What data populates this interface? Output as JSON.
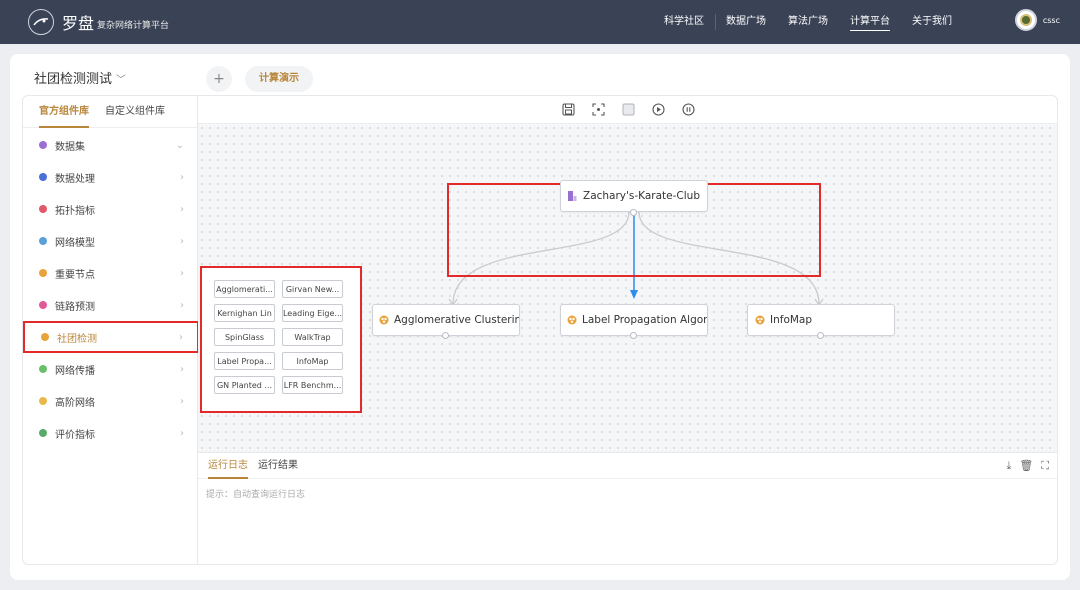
{
  "header": {
    "logo_title": "罗盘",
    "logo_subtitle": "复杂网络计算平台",
    "nav": [
      "科学社区",
      "数据广场",
      "算法广场",
      "计算平台",
      "关于我们"
    ],
    "active_nav": "计算平台",
    "user": "cssc"
  },
  "project": {
    "title": "社团检测测试",
    "add_label": "+",
    "demo_button": "计算演示"
  },
  "sidebar": {
    "tabs": [
      "官方组件库",
      "自定义组件库"
    ],
    "items": [
      {
        "label": "数据集",
        "icon": "dataset-icon",
        "color": "#9b6fd1",
        "arrow": "⌄"
      },
      {
        "label": "数据处理",
        "icon": "data-process-icon",
        "color": "#4a6fd8",
        "arrow": "›"
      },
      {
        "label": "拓扑指标",
        "icon": "topology-icon",
        "color": "#e05a6a",
        "arrow": "›"
      },
      {
        "label": "网络模型",
        "icon": "network-model-icon",
        "color": "#5aa0d8",
        "arrow": "›"
      },
      {
        "label": "重要节点",
        "icon": "key-node-icon",
        "color": "#e8a33a",
        "arrow": "›"
      },
      {
        "label": "链路预测",
        "icon": "link-predict-icon",
        "color": "#e05a9a",
        "arrow": "›"
      },
      {
        "label": "社团检测",
        "icon": "community-icon",
        "color": "#e8a33a",
        "arrow": "›"
      },
      {
        "label": "网络传播",
        "icon": "spread-icon",
        "color": "#6bbf6b",
        "arrow": "›"
      },
      {
        "label": "高阶网络",
        "icon": "high-order-icon",
        "color": "#e8b84a",
        "arrow": "›"
      },
      {
        "label": "评价指标",
        "icon": "evaluation-icon",
        "color": "#5aaa6b",
        "arrow": "›"
      }
    ]
  },
  "components": [
    "Agglomerati...",
    "Girvan New...",
    "Kernighan Lin",
    "Leading Eige...",
    "SpinGlass",
    "WalkTrap",
    "Label Propa...",
    "InfoMap",
    "GN Planted ...",
    "LFR Benchm..."
  ],
  "nodes": {
    "source": "Zachary's-Karate-Club",
    "targets": [
      "Agglomerative Clustering",
      "Label Propagation Algorith",
      "InfoMap"
    ]
  },
  "log": {
    "tabs": [
      "运行日志",
      "运行结果"
    ],
    "hint": "提示：自动查询运行日志"
  },
  "colors": {
    "accent": "#b8863b",
    "highlight": "#e32a2a",
    "edge": "#2e8cf0",
    "topbar": "#3a4256"
  }
}
